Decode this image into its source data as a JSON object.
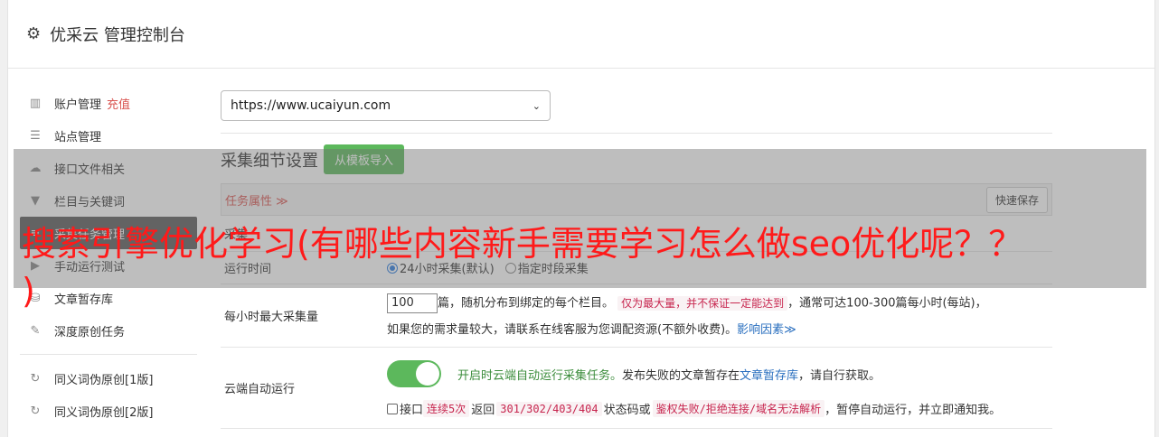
{
  "header": {
    "title": "优采云 管理控制台"
  },
  "sidebar": {
    "items": [
      {
        "label": "账户管理",
        "extra": "充值",
        "icon": "bar-chart-icon"
      },
      {
        "label": "站点管理",
        "icon": "server-icon"
      },
      {
        "label": "接口文件相关",
        "icon": "cloud-upload-icon"
      },
      {
        "label": "栏目与关键词",
        "icon": "filter-icon"
      },
      {
        "label": "采集任务管理",
        "icon": "tasks-icon"
      },
      {
        "label": "手动运行测试",
        "icon": "play-icon"
      },
      {
        "label": "文章暂存库",
        "icon": "database-icon"
      },
      {
        "label": "深度原创任务",
        "icon": "edit-icon"
      }
    ],
    "items2": [
      {
        "label": "同义词伪原创[1版]",
        "icon": "refresh-icon"
      },
      {
        "label": "同义词伪原创[2版]",
        "icon": "refresh-icon"
      }
    ]
  },
  "main": {
    "site_select": "https://www.ucaiyun.com",
    "section_title": "采集细节设置",
    "import_button": "从模板导入",
    "attr_label": "任务属性 ≫",
    "quick_save": "快速保存",
    "collect_label": "采集",
    "run_label": "运行时间",
    "run_opt1": "24小时采集(默认)",
    "run_opt2": "指定时段采集",
    "max_label": "每小时最大采集量",
    "max_value": "100",
    "max_text1": "篇，随机分布到绑定的每个栏目。",
    "max_code1": "仅为最大量，并不保证一定能达到",
    "max_text2": "，通常可达100-300篇每小时(每站)，",
    "max_text3": "如果您的需求量较大，请联系在线客服为您调配资源(不额外收费)。",
    "max_link": "影响因素≫",
    "cloud_label": "云端自动运行",
    "cloud_green": "开启时云端自动运行采集任务。",
    "cloud_text1": "发布失败的文章暂存在",
    "cloud_link": "文章暂存库",
    "cloud_text2": "，请自行获取。",
    "cloud_chk": "接口",
    "cloud_code1": "连续5次",
    "cloud_text3": "返回",
    "cloud_code2": "301/302/403/404",
    "cloud_text4": "状态码或",
    "cloud_code3": "鉴权失败/拒绝连接/域名无法解析",
    "cloud_text5": "，暂停自动运行，并立即通知我。"
  },
  "overlay": {
    "line1": "搜索引擎优化学习(有哪些内容新手需要学习怎么做seo优化呢？？",
    "line2": ")"
  },
  "colors": {
    "accent_green": "#5cb85c",
    "alert_red": "#d9534f",
    "overlay_text": "#ff1a1a"
  }
}
